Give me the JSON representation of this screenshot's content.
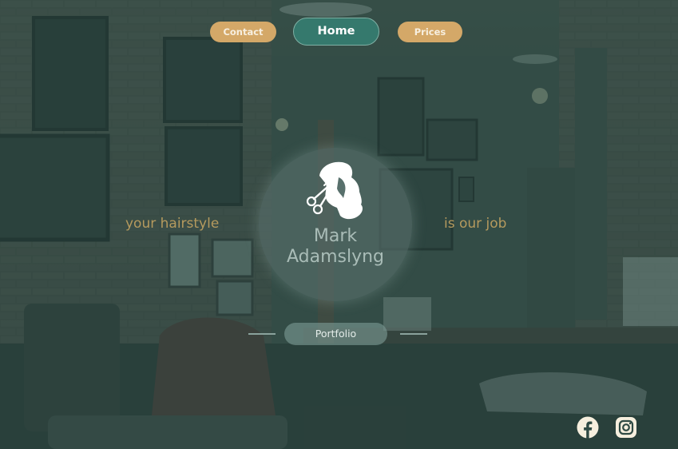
{
  "nav": {
    "contact_label": "Contact",
    "home_label": "Home",
    "prices_label": "Prices"
  },
  "hero": {
    "tagline_left": "your hairstyle",
    "tagline_right": "is our job",
    "name_first": "Mark",
    "name_last": "Adamslyng",
    "logo_icon": "barber-head-scissors-icon"
  },
  "portfolio": {
    "label": "Portfolio"
  },
  "social": {
    "facebook_icon": "facebook-icon",
    "instagram_icon": "instagram-icon"
  },
  "colors": {
    "overlay": "#2f524a",
    "nav_gold": "#d4a868",
    "home_teal": "#35796d",
    "tagline": "#b59a5e",
    "name": "#a9bcb7"
  }
}
